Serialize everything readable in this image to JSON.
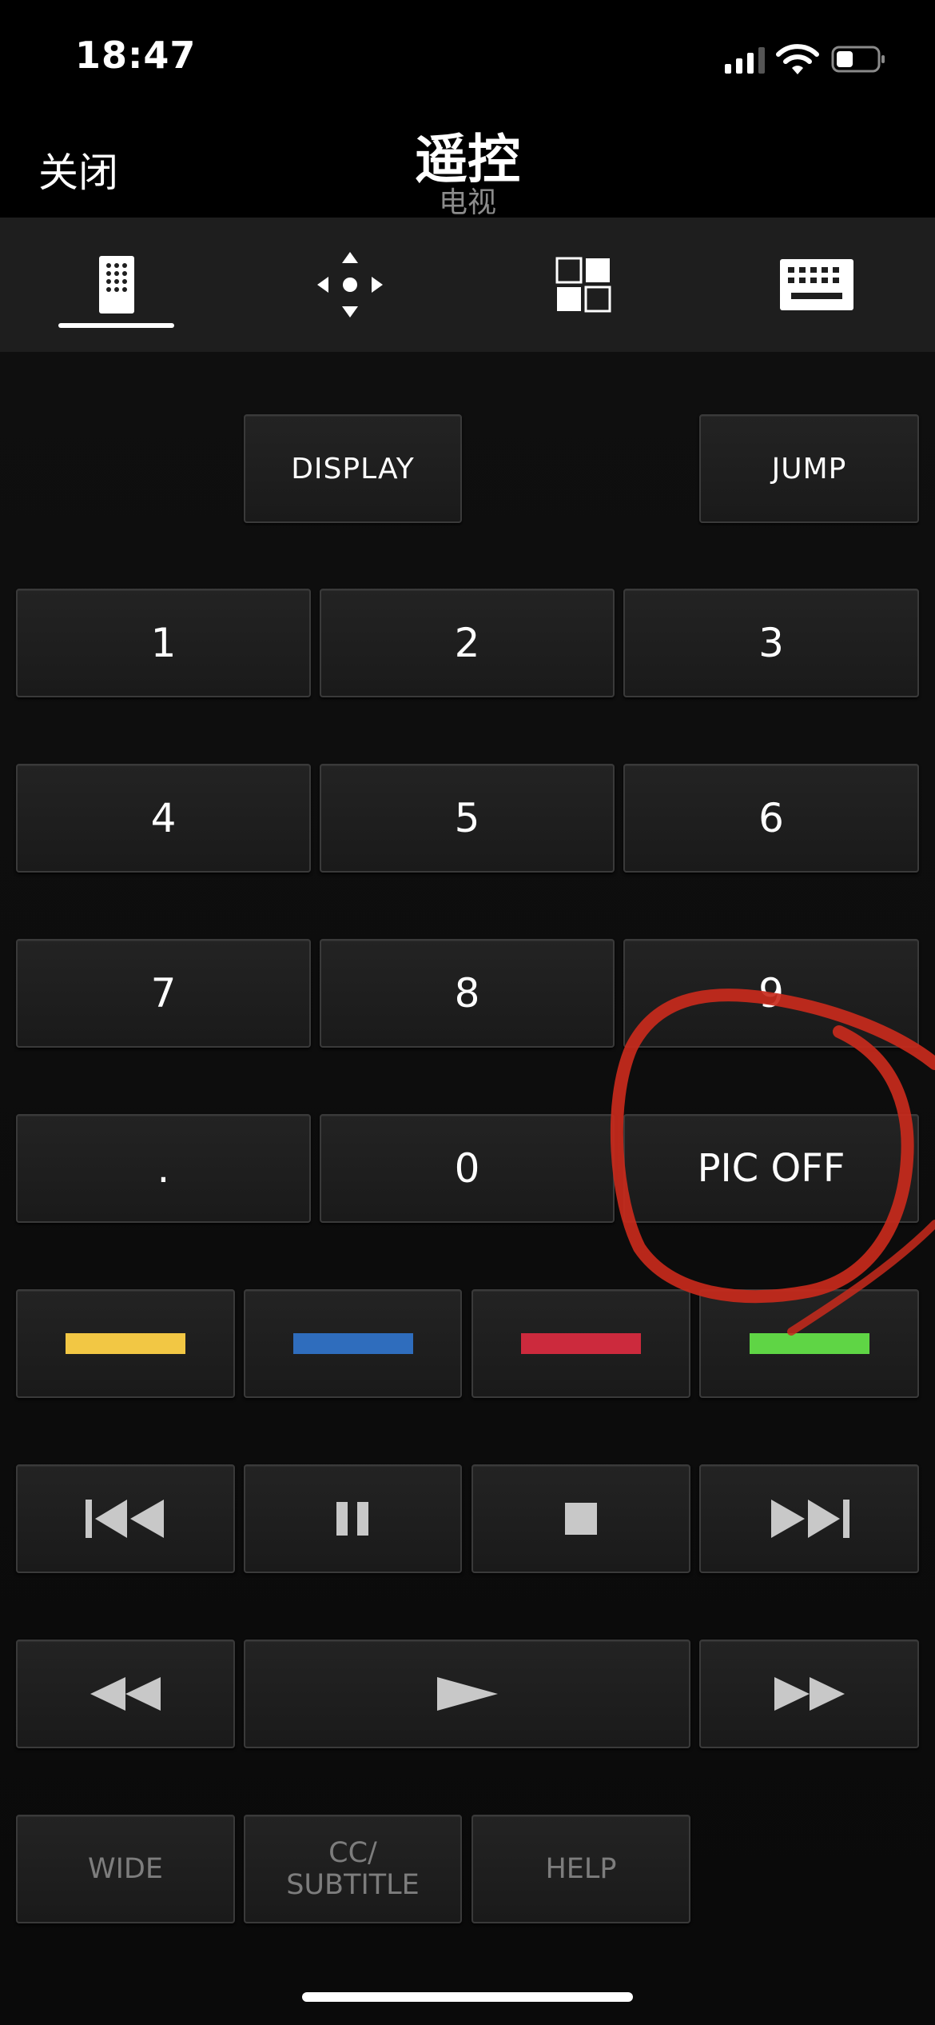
{
  "status_bar": {
    "time": "18:47"
  },
  "nav": {
    "close_label": "关闭",
    "title": "遥控",
    "subtitle": "电视"
  },
  "tabs": [
    {
      "icon": "remote-icon",
      "selected": true
    },
    {
      "icon": "dpad-icon",
      "selected": false
    },
    {
      "icon": "grid-icon",
      "selected": false
    },
    {
      "icon": "keyboard-icon",
      "selected": false
    }
  ],
  "buttons": {
    "display": "DISPLAY",
    "jump": "JUMP",
    "numbers": [
      "1",
      "2",
      "3",
      "4",
      "5",
      "6",
      "7",
      "8",
      "9"
    ],
    "dot": ".",
    "zero": "0",
    "pic_off": "PIC OFF",
    "wide": "WIDE",
    "cc_line1": "CC/",
    "cc_line2": "SUBTITLE",
    "help": "HELP"
  },
  "color_keys": [
    "#f2c744",
    "#2f6dbd",
    "#cc2a3d",
    "#5fd545"
  ],
  "transport_icons": [
    "skip-back-icon",
    "pause-icon",
    "stop-icon",
    "skip-forward-icon",
    "rewind-icon",
    "play-icon",
    "fast-forward-icon"
  ],
  "annotation_color": "#c82a1c"
}
